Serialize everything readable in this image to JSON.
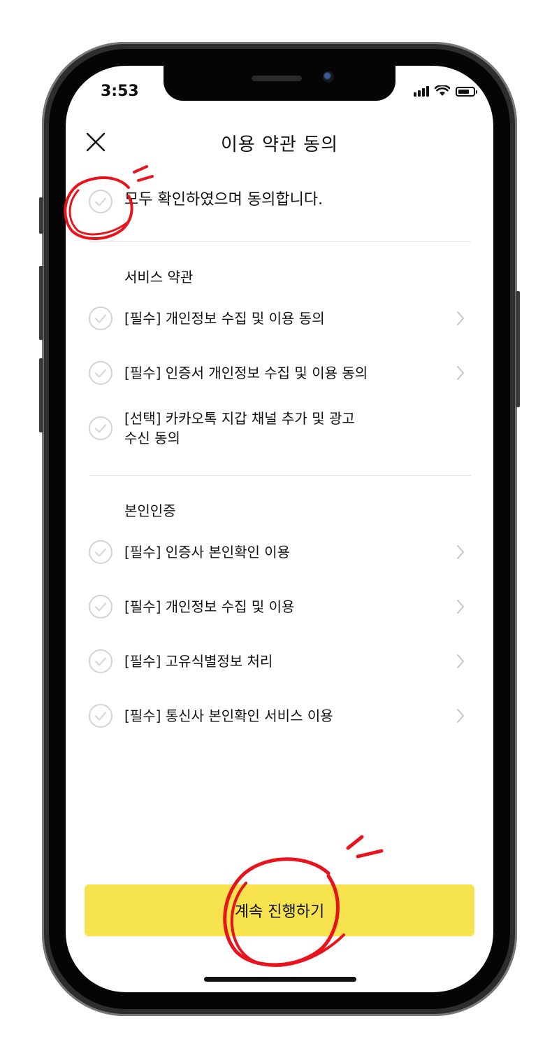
{
  "status_bar": {
    "time": "3:53",
    "battery_level": 0.75
  },
  "header": {
    "title": "이용 약관 동의",
    "close_icon": "close-icon"
  },
  "agree_all": {
    "label": "모두 확인하였으며 동의합니다."
  },
  "sections": [
    {
      "title": "서비스 약관",
      "items": [
        {
          "label": "[필수] 개인정보 수집 및 이용 동의",
          "has_chevron": true
        },
        {
          "label": "[필수] 인증서 개인정보 수집 및 이용 동의",
          "has_chevron": true
        },
        {
          "label_line1": "[선택] 카카오톡 지갑 채널 추가 및 광고",
          "label_line2": "수신 동의",
          "has_chevron": false
        }
      ]
    },
    {
      "title": "본인인증",
      "items": [
        {
          "label": "[필수] 인증사 본인확인 이용",
          "has_chevron": true
        },
        {
          "label": "[필수] 개인정보 수집 및 이용",
          "has_chevron": true
        },
        {
          "label": "[필수] 고유식별정보 처리",
          "has_chevron": true
        },
        {
          "label": "[필수] 통신사 본인확인 서비스 이용",
          "has_chevron": true
        }
      ]
    }
  ],
  "cta": {
    "label": "계속 진행하기"
  },
  "colors": {
    "accent_yellow": "#F7E34D",
    "check_gray": "#D4D4D4",
    "annotation_red": "#E8131B",
    "chevron_gray": "#C4C4C4"
  }
}
